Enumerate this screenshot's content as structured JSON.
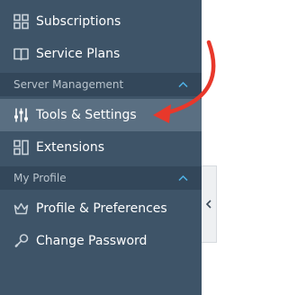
{
  "nav": {
    "items_top": [
      {
        "label": "Subscriptions",
        "icon": "subscriptions-icon"
      },
      {
        "label": "Service Plans",
        "icon": "book-icon"
      }
    ],
    "sections": [
      {
        "title": "Server Management",
        "items": [
          {
            "label": "Tools & Settings",
            "icon": "tools-settings-icon",
            "active": true
          },
          {
            "label": "Extensions",
            "icon": "extensions-icon"
          }
        ]
      },
      {
        "title": "My Profile",
        "items": [
          {
            "label": "Profile & Preferences",
            "icon": "crown-icon"
          },
          {
            "label": "Change Password",
            "icon": "key-icon"
          }
        ]
      }
    ]
  },
  "colors": {
    "sidebar_bg": "#3e5468",
    "section_bg": "#33475a",
    "active_bg": "#5a6f82",
    "accent_chevron": "#4fb3e8",
    "annotation_arrow": "#e8382b"
  },
  "collapse_tab": {
    "icon": "chevron-left-icon"
  },
  "annotation": {
    "icon": "red-arrow-annotation"
  }
}
